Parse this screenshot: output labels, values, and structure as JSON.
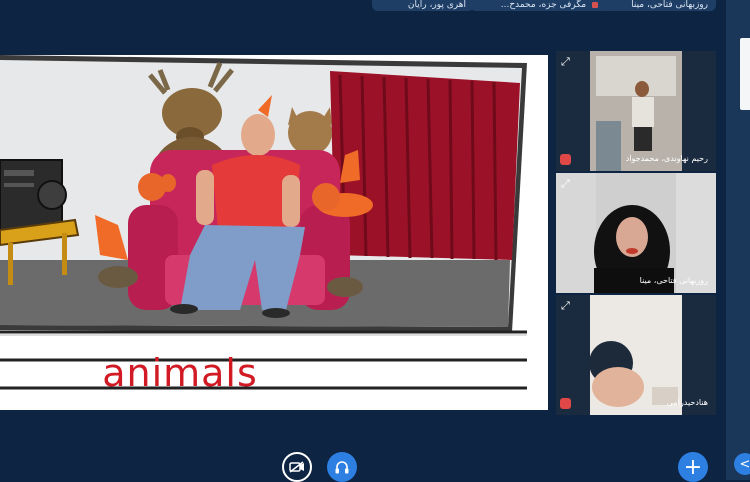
{
  "top_bar": {
    "chips": [
      {
        "name": "روزبهانی فتاحی، مینا"
      },
      {
        "name": "مگرفی جزه، محمدح..."
      },
      {
        "name": "اهری پور، رایان"
      }
    ]
  },
  "presentation": {
    "word": "animals"
  },
  "participants": [
    {
      "name": "رحیم نهاوندی، محمدجواد"
    },
    {
      "name": "روزبهانی فتاحی، مینا"
    },
    {
      "name": "هنادحیدرامی"
    }
  ],
  "toolbar": {
    "buttons": [
      {
        "icon": "camera-off-icon"
      },
      {
        "icon": "headphones-icon"
      },
      {
        "icon": "plus-icon",
        "label": "+"
      },
      {
        "icon": "chevron-left-icon",
        "label": "<"
      }
    ]
  },
  "colors": {
    "background": "#0d2443",
    "accent": "#2d7fe2",
    "word": "#d11a24",
    "chair": "#c7265a",
    "curtain": "#9b1228"
  }
}
